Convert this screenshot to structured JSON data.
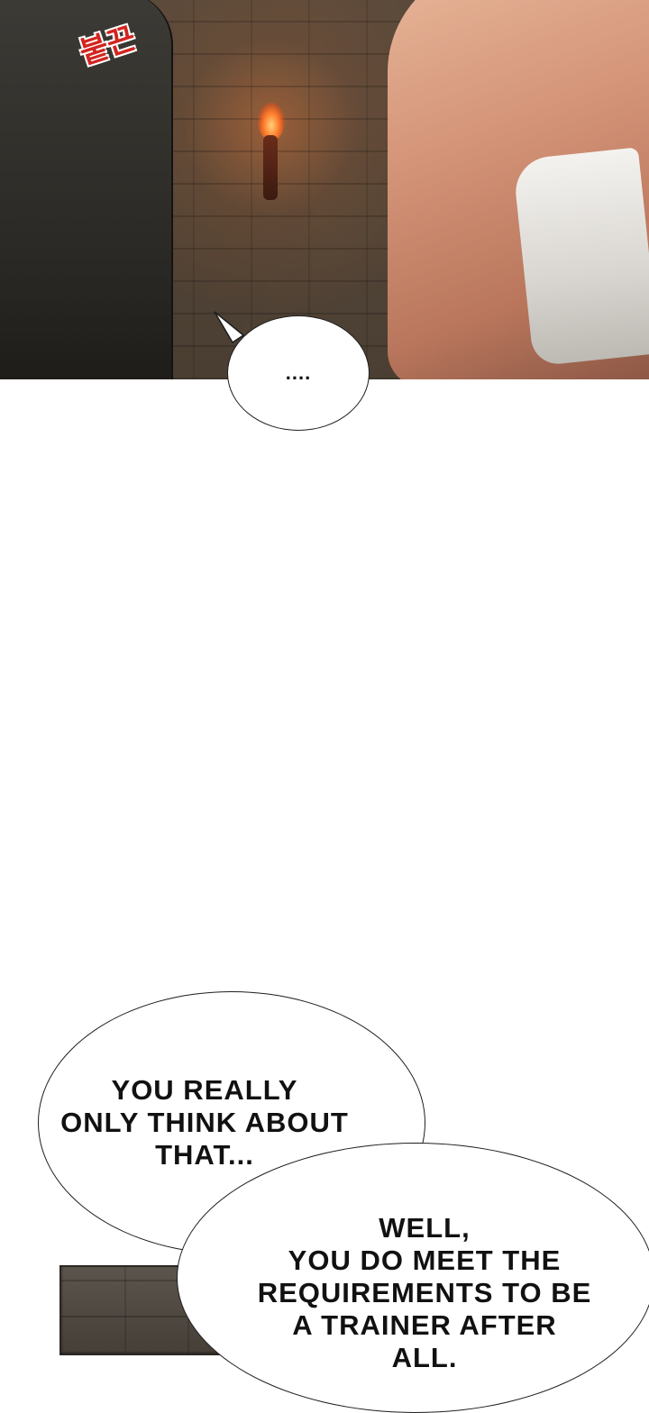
{
  "panels": {
    "top": {
      "sfx_text": "붙끈",
      "bubble_text": "....",
      "colors": {
        "sfx": "#d3241f",
        "flame": "#ff7a2a"
      }
    },
    "bottom": {
      "bubble_1_text": "YOU REALLY\nONLY THINK ABOUT\nTHAT...",
      "bubble_2_text": "WELL,\nYOU DO MEET THE\nREQUIREMENTS TO BE\nA TRAINER AFTER\nALL."
    }
  }
}
